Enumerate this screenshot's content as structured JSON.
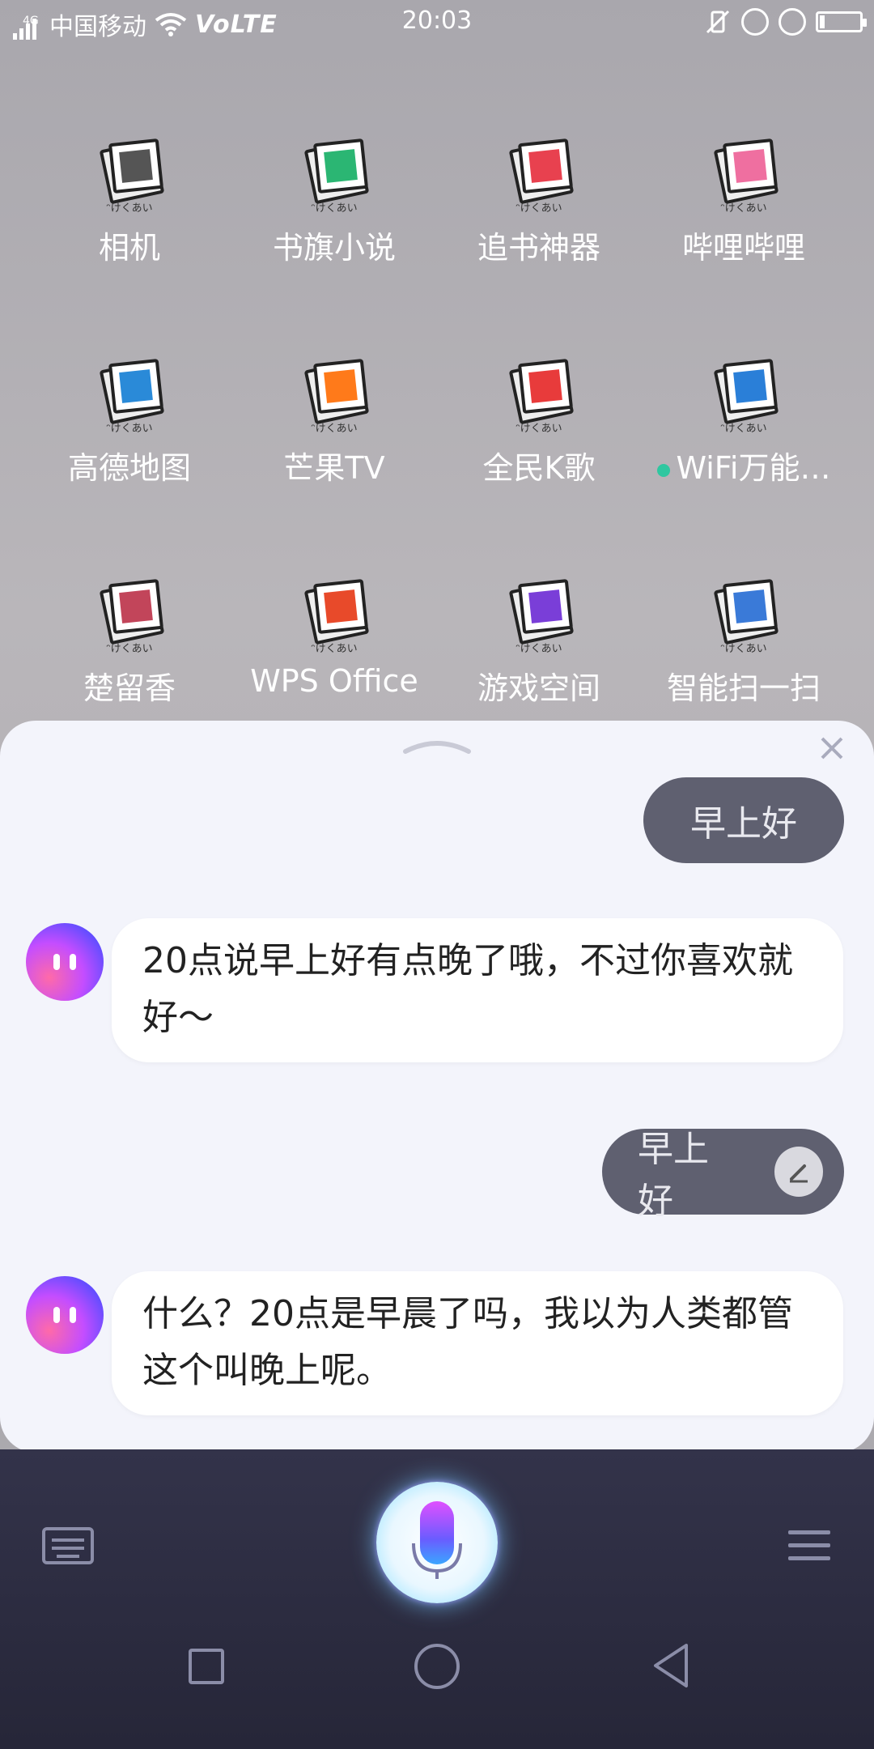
{
  "status_bar": {
    "network": "4G",
    "carrier": "中国移动",
    "volte": "VoLTE",
    "time": "20:03",
    "icons": [
      "signal-icon",
      "wifi-icon",
      "vibrate-icon",
      "rotation-lock-icon",
      "alarm-icon",
      "battery-icon"
    ]
  },
  "apps": [
    {
      "label": "相机",
      "sub": "ᵔけくあい",
      "color": "#555555"
    },
    {
      "label": "书旗小说",
      "sub": "ᵔけくあい",
      "color": "#2bb673"
    },
    {
      "label": "追书神器",
      "sub": "ᵔけくあい",
      "color": "#e8414f"
    },
    {
      "label": "哔哩哔哩",
      "sub": "ᵔけくあい",
      "color": "#ef6fa0"
    },
    {
      "label": "高德地图",
      "sub": "ᵔけくあい",
      "color": "#2a8ad8"
    },
    {
      "label": "芒果TV",
      "sub": "ᵔけくあい",
      "color": "#ff7a1a"
    },
    {
      "label": "全民K歌",
      "sub": "ᵔけくあい",
      "color": "#e83b3b"
    },
    {
      "label": "WiFi万能…",
      "sub": "ᵔけくあい",
      "color": "#2a7fd8"
    },
    {
      "label": "楚留香",
      "sub": "ᵔけくあい",
      "color": "#c2455a"
    },
    {
      "label": "WPS Office",
      "sub": "ᵔけくあい",
      "color": "#e84a2a"
    },
    {
      "label": "游戏空间",
      "sub": "ᵔけくあい",
      "color": "#7a3ed8"
    },
    {
      "label": "智能扫一扫",
      "sub": "ᵔけくあい",
      "color": "#3a7ad8"
    }
  ],
  "chat": {
    "messages": [
      {
        "role": "user",
        "text": "早上好"
      },
      {
        "role": "assistant",
        "text": "20点说早上好有点晚了哦，不过你喜欢就好～"
      },
      {
        "role": "user",
        "text": "早上好",
        "editable": true
      },
      {
        "role": "assistant",
        "text": "什么？20点是早晨了吗，我以为人类都管这个叫晚上呢。"
      }
    ]
  },
  "bottom_bar": {
    "keyboard_icon": "keyboard-icon",
    "mic_icon": "microphone-icon",
    "menu_icon": "menu-icon"
  },
  "navbar": {
    "icons": [
      "recent-apps-icon",
      "home-icon",
      "back-icon"
    ]
  },
  "colors": {
    "user_bubble": "#5f6070",
    "panel": "#f3f4fb",
    "bottom": "#2c2c42",
    "accent": "#7a5cff"
  }
}
